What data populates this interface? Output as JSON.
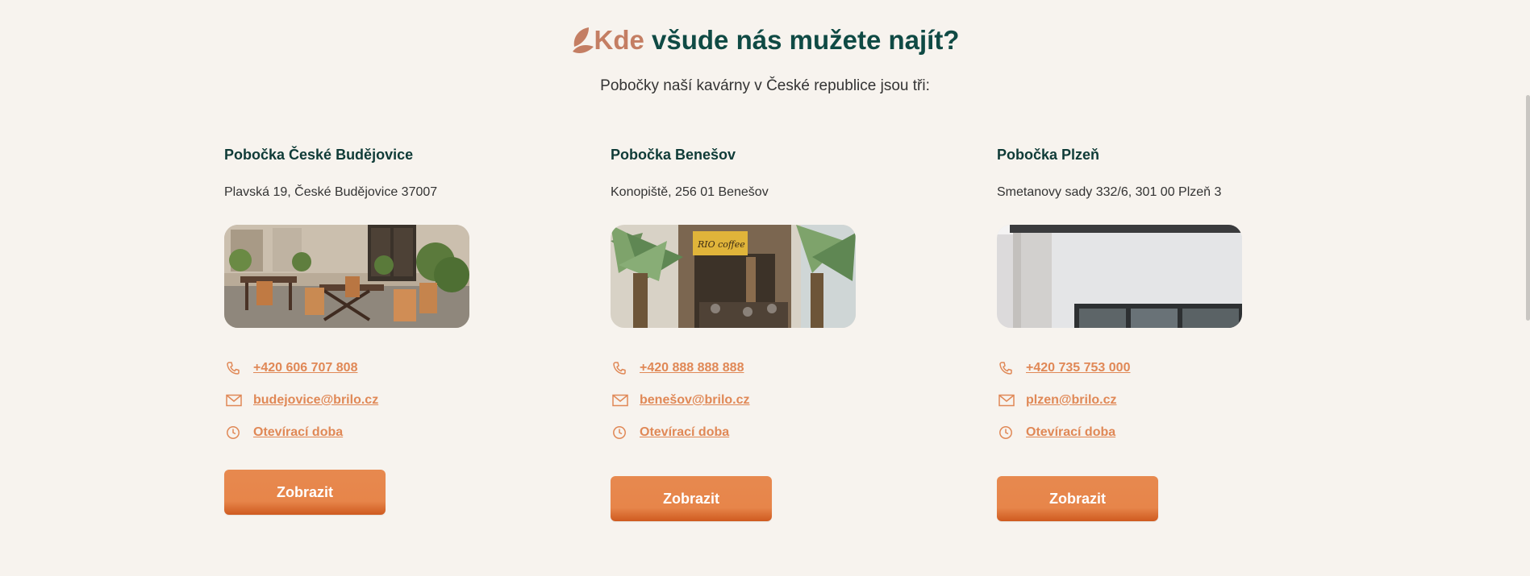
{
  "heading": {
    "accent": "Kde",
    "rest": " všude nás mužete najít?"
  },
  "subtitle": "Pobočky naší kavárny v České republice jsou tři:",
  "branches": [
    {
      "title": "Pobočka České Budějovice",
      "address": "Plavská 19, České Budějovice 37007",
      "phone": "+420 606 707 808",
      "email": "budejovice@brilo.cz",
      "hours": "Otevírací doba",
      "button": "Zobrazit"
    },
    {
      "title": "Pobočka Benešov",
      "address": "Konopiště, 256 01 Benešov",
      "phone": "+420 888 888 888",
      "email": "benešov@brilo.cz",
      "hours": "Otevírací doba",
      "button": "Zobrazit",
      "sign_text": "RIO coffee"
    },
    {
      "title": "Pobočka Plzeň",
      "address": "Smetanovy sady 332/6, 301 00 Plzeň 3",
      "phone": "+420 735 753 000",
      "email": "plzen@brilo.cz",
      "hours": "Otevírací doba",
      "button": "Zobrazit"
    }
  ],
  "icons": {
    "leaf": "leaf-icon",
    "phone": "phone-icon",
    "email": "envelope-icon",
    "hours": "clock-icon"
  },
  "colors": {
    "background": "#f7f3ee",
    "accent": "#c47e63",
    "heading": "#0f4a44",
    "link": "#e08856",
    "button": "#e7854a"
  }
}
